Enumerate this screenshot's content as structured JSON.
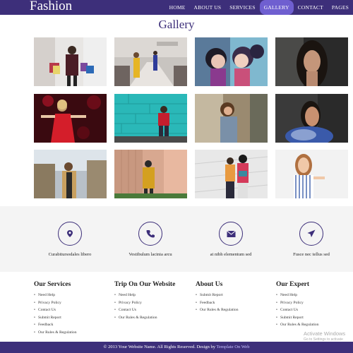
{
  "header": {
    "brand": "Fashion",
    "nav": [
      {
        "label": "HOME"
      },
      {
        "label": "ABOUT US"
      },
      {
        "label": "SERVICES"
      },
      {
        "label": "GALLERY",
        "active": true
      },
      {
        "label": "CONTACT"
      },
      {
        "label": "PAGES"
      }
    ]
  },
  "gallery": {
    "title": "Gallery"
  },
  "services": [
    {
      "icon": "location-pin-icon",
      "text": "Curabitursodales libero"
    },
    {
      "icon": "phone-icon",
      "text": "Vestibulum lacinia arcu"
    },
    {
      "icon": "envelope-icon",
      "text": "at nibh elementum sed"
    },
    {
      "icon": "send-icon",
      "text": "Fusce nec tellus sed"
    }
  ],
  "footer": {
    "columns": [
      {
        "title": "Our Services",
        "items": [
          "Need Help",
          "Privacy Policy",
          "Contact Us",
          "Submit Report",
          "Feedback",
          "Our Rules & Regulation"
        ]
      },
      {
        "title": "Trip On Our Website",
        "items": [
          "Need Help",
          "Privacy Policy",
          "Contact Us",
          "Our Rules & Regulation"
        ]
      },
      {
        "title": "About Us",
        "items": [
          "Submit Report",
          "Feedback",
          "Our Rules & Regulation"
        ]
      },
      {
        "title": "Our Expert",
        "items": [
          "Need Help",
          "Privacy Policy",
          "Contact Us",
          "Submit Report",
          "Our Rules & Regulation"
        ]
      }
    ],
    "copyright": "© 2013 Your Website Name. All Rights Reserved. Design by",
    "designer": "Template On Web"
  },
  "watermark": {
    "line1": "Activate Windows",
    "line2": "Go to Settings to activate Windows."
  },
  "colors": {
    "primary": "#3d2f7a",
    "nav_active": "#6f5fd0"
  }
}
